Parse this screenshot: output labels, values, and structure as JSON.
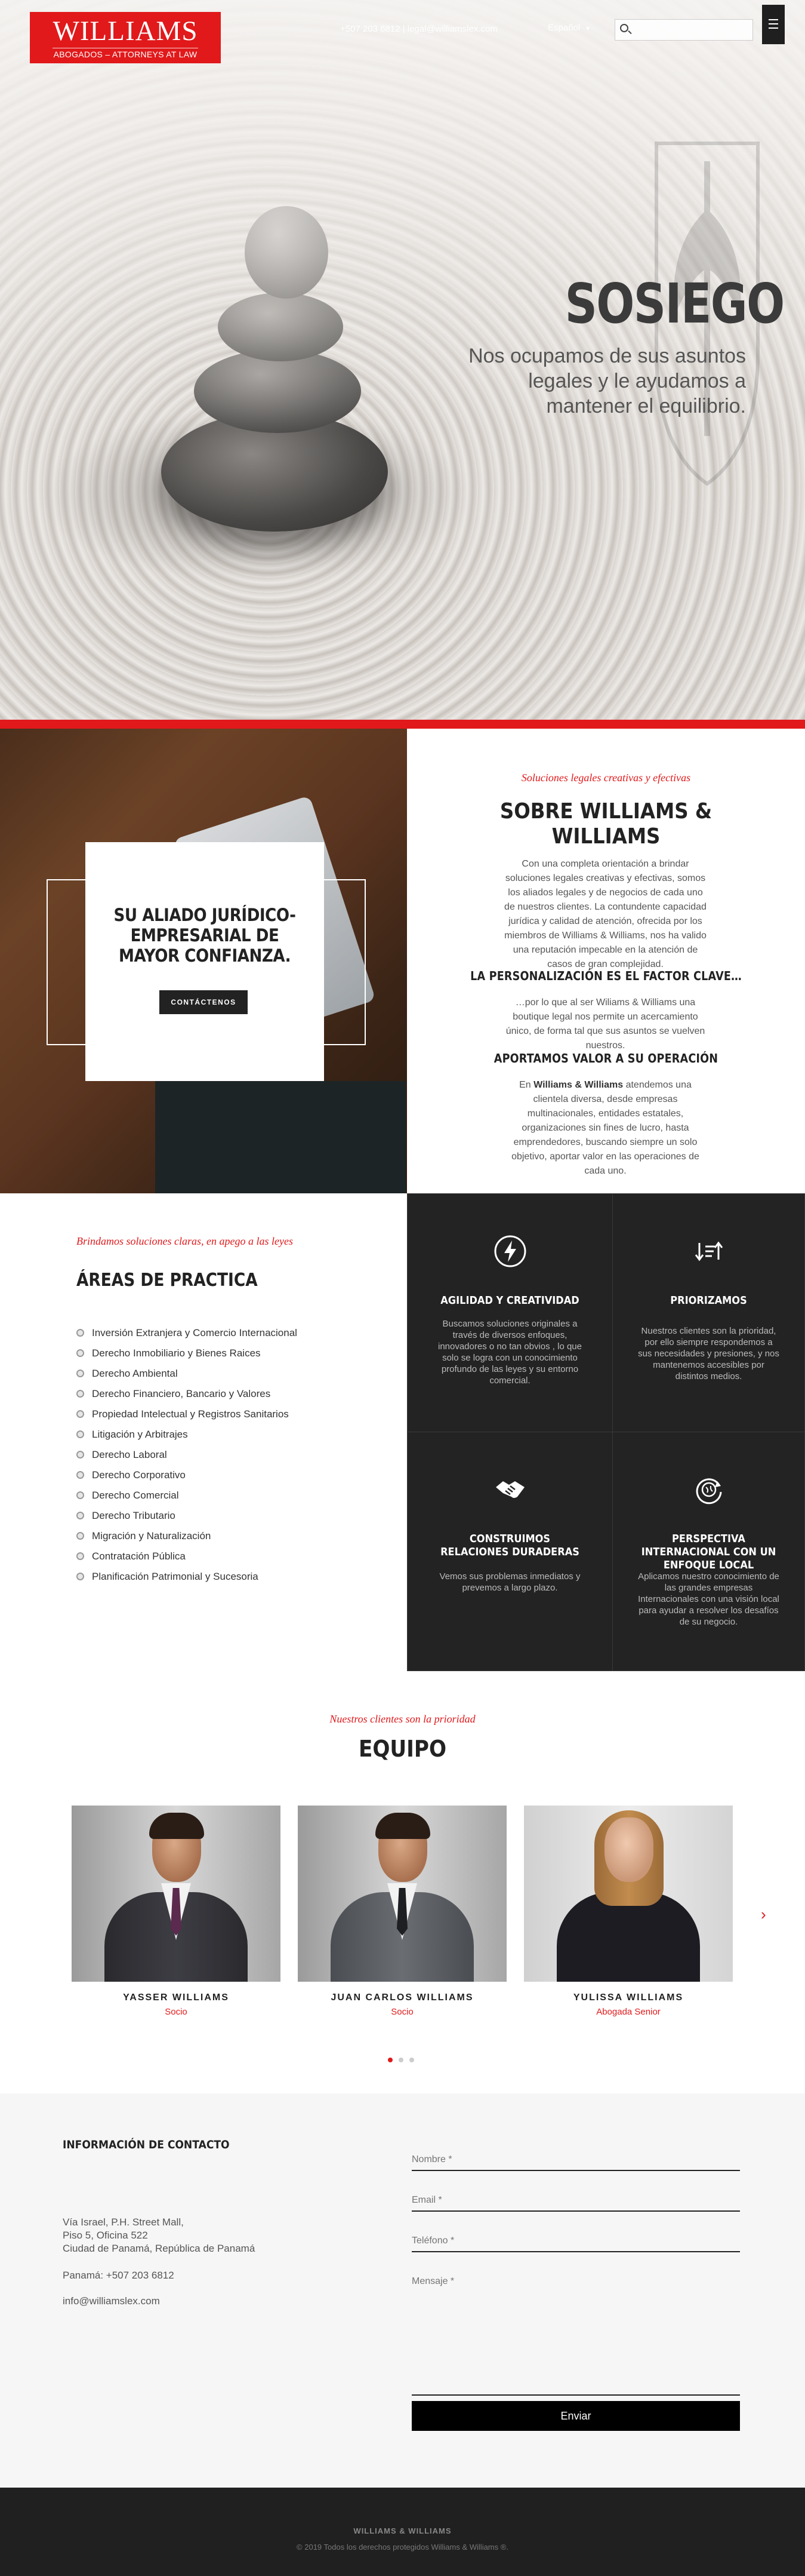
{
  "header": {
    "logo_name": "WILLIAMS",
    "logo_tagline": "ABOGADOS – ATTORNEYS AT LAW",
    "contact": "+507 203 6812  |  legal@williamslex.com",
    "language": "Español",
    "search_placeholder": ""
  },
  "hero": {
    "title": "SOSIEGO",
    "subtitle": "Nos ocupamos de sus asuntos legales y le ayudamos a mantener el equilibrio."
  },
  "about": {
    "card_title": "SU ALIADO JURÍDICO-EMPRESARIAL DE MAYOR CONFIANZA.",
    "card_button": "CONTÁCTENOS",
    "kicker": "Soluciones legales creativas y efectivas",
    "title": "SOBRE WILLIAMS & WILLIAMS",
    "paragraph1": "Con una completa orientación a brindar soluciones legales creativas y efectivas, somos los aliados legales y de negocios de cada uno de nuestros clientes.  La contundente capacidad jurídica y calidad de atención, ofrecida por los miembros de Williams & Williams, nos ha valido una reputación impecable en la atención de casos de gran complejidad.",
    "heading2": "LA PERSONALIZACIÓN ES EL FACTOR CLAVE…",
    "paragraph2": "…por lo que al ser Wiliams & Williams una boutique legal nos permite un acercamiento único, de forma tal que sus asuntos se vuelven nuestros.",
    "heading3": "APORTAMOS VALOR A SU OPERACIÓN",
    "paragraph3_prefix": "En ",
    "paragraph3_bold": "Williams & Williams",
    "paragraph3_rest": " atendemos una clientela diversa, desde empresas multinacionales, entidades estatales, organizaciones sin fines de lucro, hasta emprendedores, buscando siempre un solo objetivo, aportar valor en las operaciones de cada uno."
  },
  "practice": {
    "kicker": "Brindamos soluciones claras, en apego a las leyes",
    "title": "ÁREAS DE PRACTICA",
    "areas": [
      "Inversión Extranjera y Comercio Internacional",
      "Derecho Inmobiliario y Bienes Raices",
      "Derecho Ambiental",
      "Derecho Financiero, Bancario y Valores",
      "Propiedad Intelectual y Registros Sanitarios",
      "Litigación y Arbitrajes",
      "Derecho Laboral",
      "Derecho Corporativo",
      "Derecho Comercial",
      "Derecho Tributario",
      "Migración y Naturalización",
      "Contratación Pública",
      "Planificación Patrimonial y Sucesoria"
    ]
  },
  "features": [
    {
      "icon": "bolt-icon",
      "title": "AGILIDAD Y CREATIVIDAD",
      "text": "Buscamos soluciones originales a través de diversos enfoques, innovadores o no tan obvios , lo que solo se logra con un conocimiento profundo de las leyes y su entorno comercial."
    },
    {
      "icon": "priority-arrows-icon",
      "title": "PRIORIZAMOS",
      "text": "Nuestros clientes son la prioridad, por ello siempre respondemos a sus necesidades y presiones, y nos mantenemos accesibles por distintos medios."
    },
    {
      "icon": "handshake-icon",
      "title": "CONSTRUIMOS RELACIONES DURADERAS",
      "text": "Vemos sus problemas inmediatos y prevemos a largo plazo."
    },
    {
      "icon": "globe-refresh-icon",
      "title": "PERSPECTIVA INTERNACIONAL CON UN ENFOQUE LOCAL",
      "text": "Aplicamos nuestro conocimiento de las grandes empresas Internacionales con una visión local para ayudar a resolver los desafíos de su negocio."
    }
  ],
  "team": {
    "kicker": "Nuestros clientes son la prioridad",
    "title": "EQUIPO",
    "members": [
      {
        "name": "YASSER WILLIAMS",
        "role": "Socio"
      },
      {
        "name": "JUAN CARLOS WILLIAMS",
        "role": "Socio"
      },
      {
        "name": "YULISSA WILLIAMS",
        "role": "Abogada Senior"
      }
    ],
    "active_slide": 1,
    "slide_count": 3
  },
  "contact": {
    "title": "INFORMACIÓN DE CONTACTO",
    "address_line1": "Vía Israel, P.H. Street Mall,",
    "address_line2": "Piso 5, Oficina 522",
    "address_line3": "Ciudad de Panamá, República de Panamá",
    "phone": "Panamá: +507 203 6812",
    "email": "info@williamslex.com",
    "form": {
      "name_placeholder": "Nombre *",
      "email_placeholder": "Email *",
      "phone_placeholder": "Teléfono *",
      "message_placeholder": "Mensaje *",
      "submit": "Enviar"
    }
  },
  "footer": {
    "brand": "WILLIAMS & WILLIAMS",
    "copyright": "© 2019 Todos los derechos protegidos Williams & Williams ®."
  },
  "colors": {
    "accent": "#e1191b",
    "dark": "#232323"
  }
}
